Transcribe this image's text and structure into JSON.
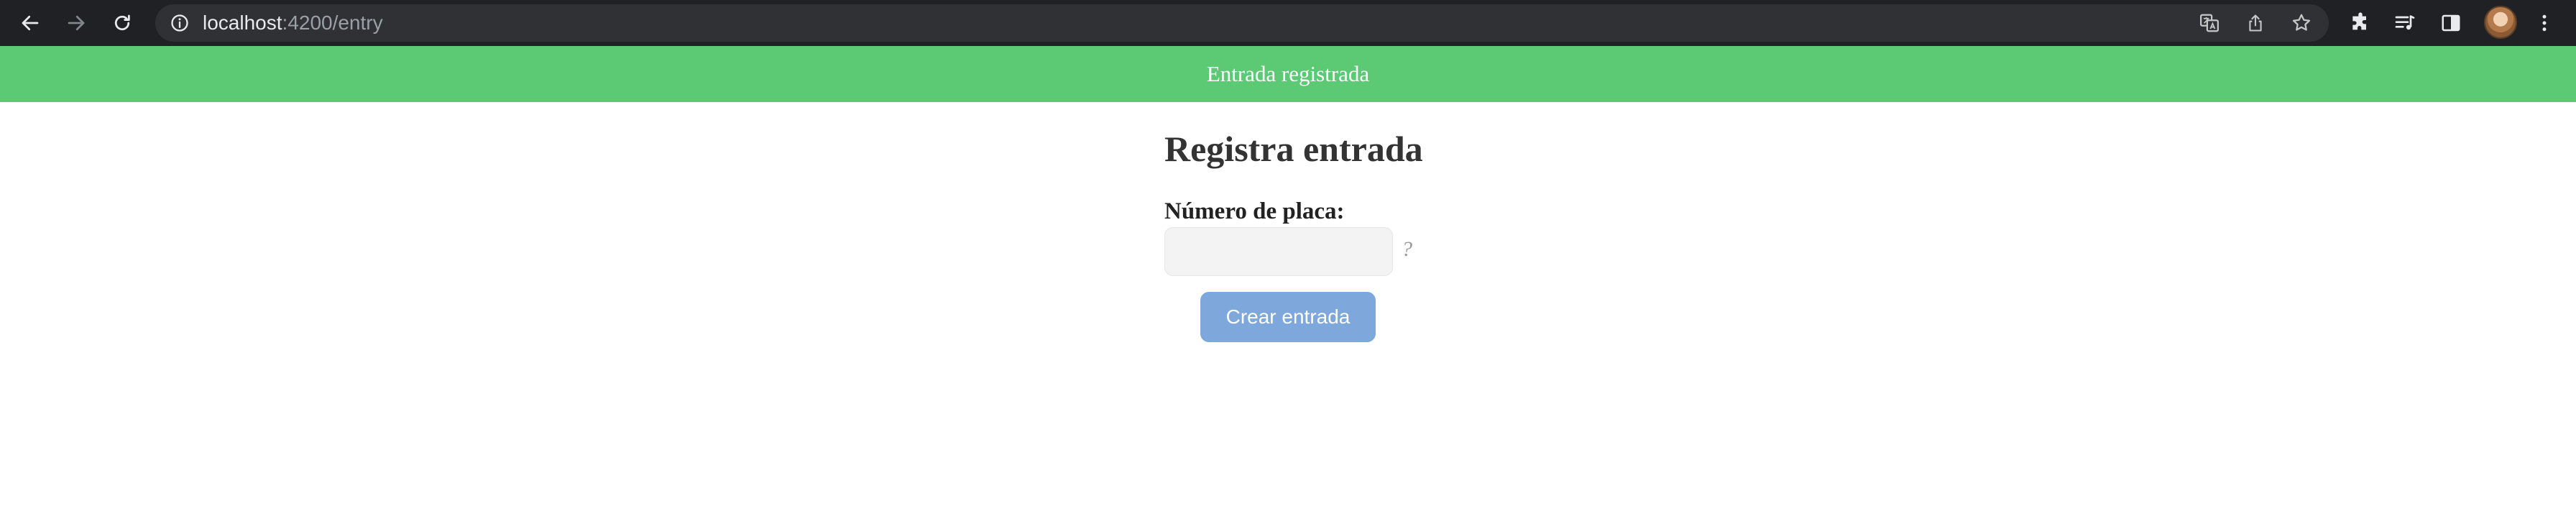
{
  "browser": {
    "url_host": "localhost",
    "url_path": ":4200/entry",
    "icons": {
      "back": "back-arrow-icon",
      "forward": "forward-arrow-icon",
      "reload": "reload-icon",
      "site_info": "info-icon",
      "translate": "translate-icon",
      "share": "share-icon",
      "bookmark": "star-icon",
      "extensions": "puzzle-icon",
      "reading_list": "reading-list-icon",
      "side_panel": "side-panel-icon",
      "profile": "avatar",
      "menu": "kebab-menu-icon"
    }
  },
  "banner": {
    "message": "Entrada registrada",
    "color": "#5cc975"
  },
  "form": {
    "title": "Registra entrada",
    "plate_label": "Número de placa:",
    "plate_value": "",
    "plate_placeholder": "",
    "help_mark": "?",
    "submit_label": "Crear entrada",
    "submit_color": "#7ea7dc"
  }
}
